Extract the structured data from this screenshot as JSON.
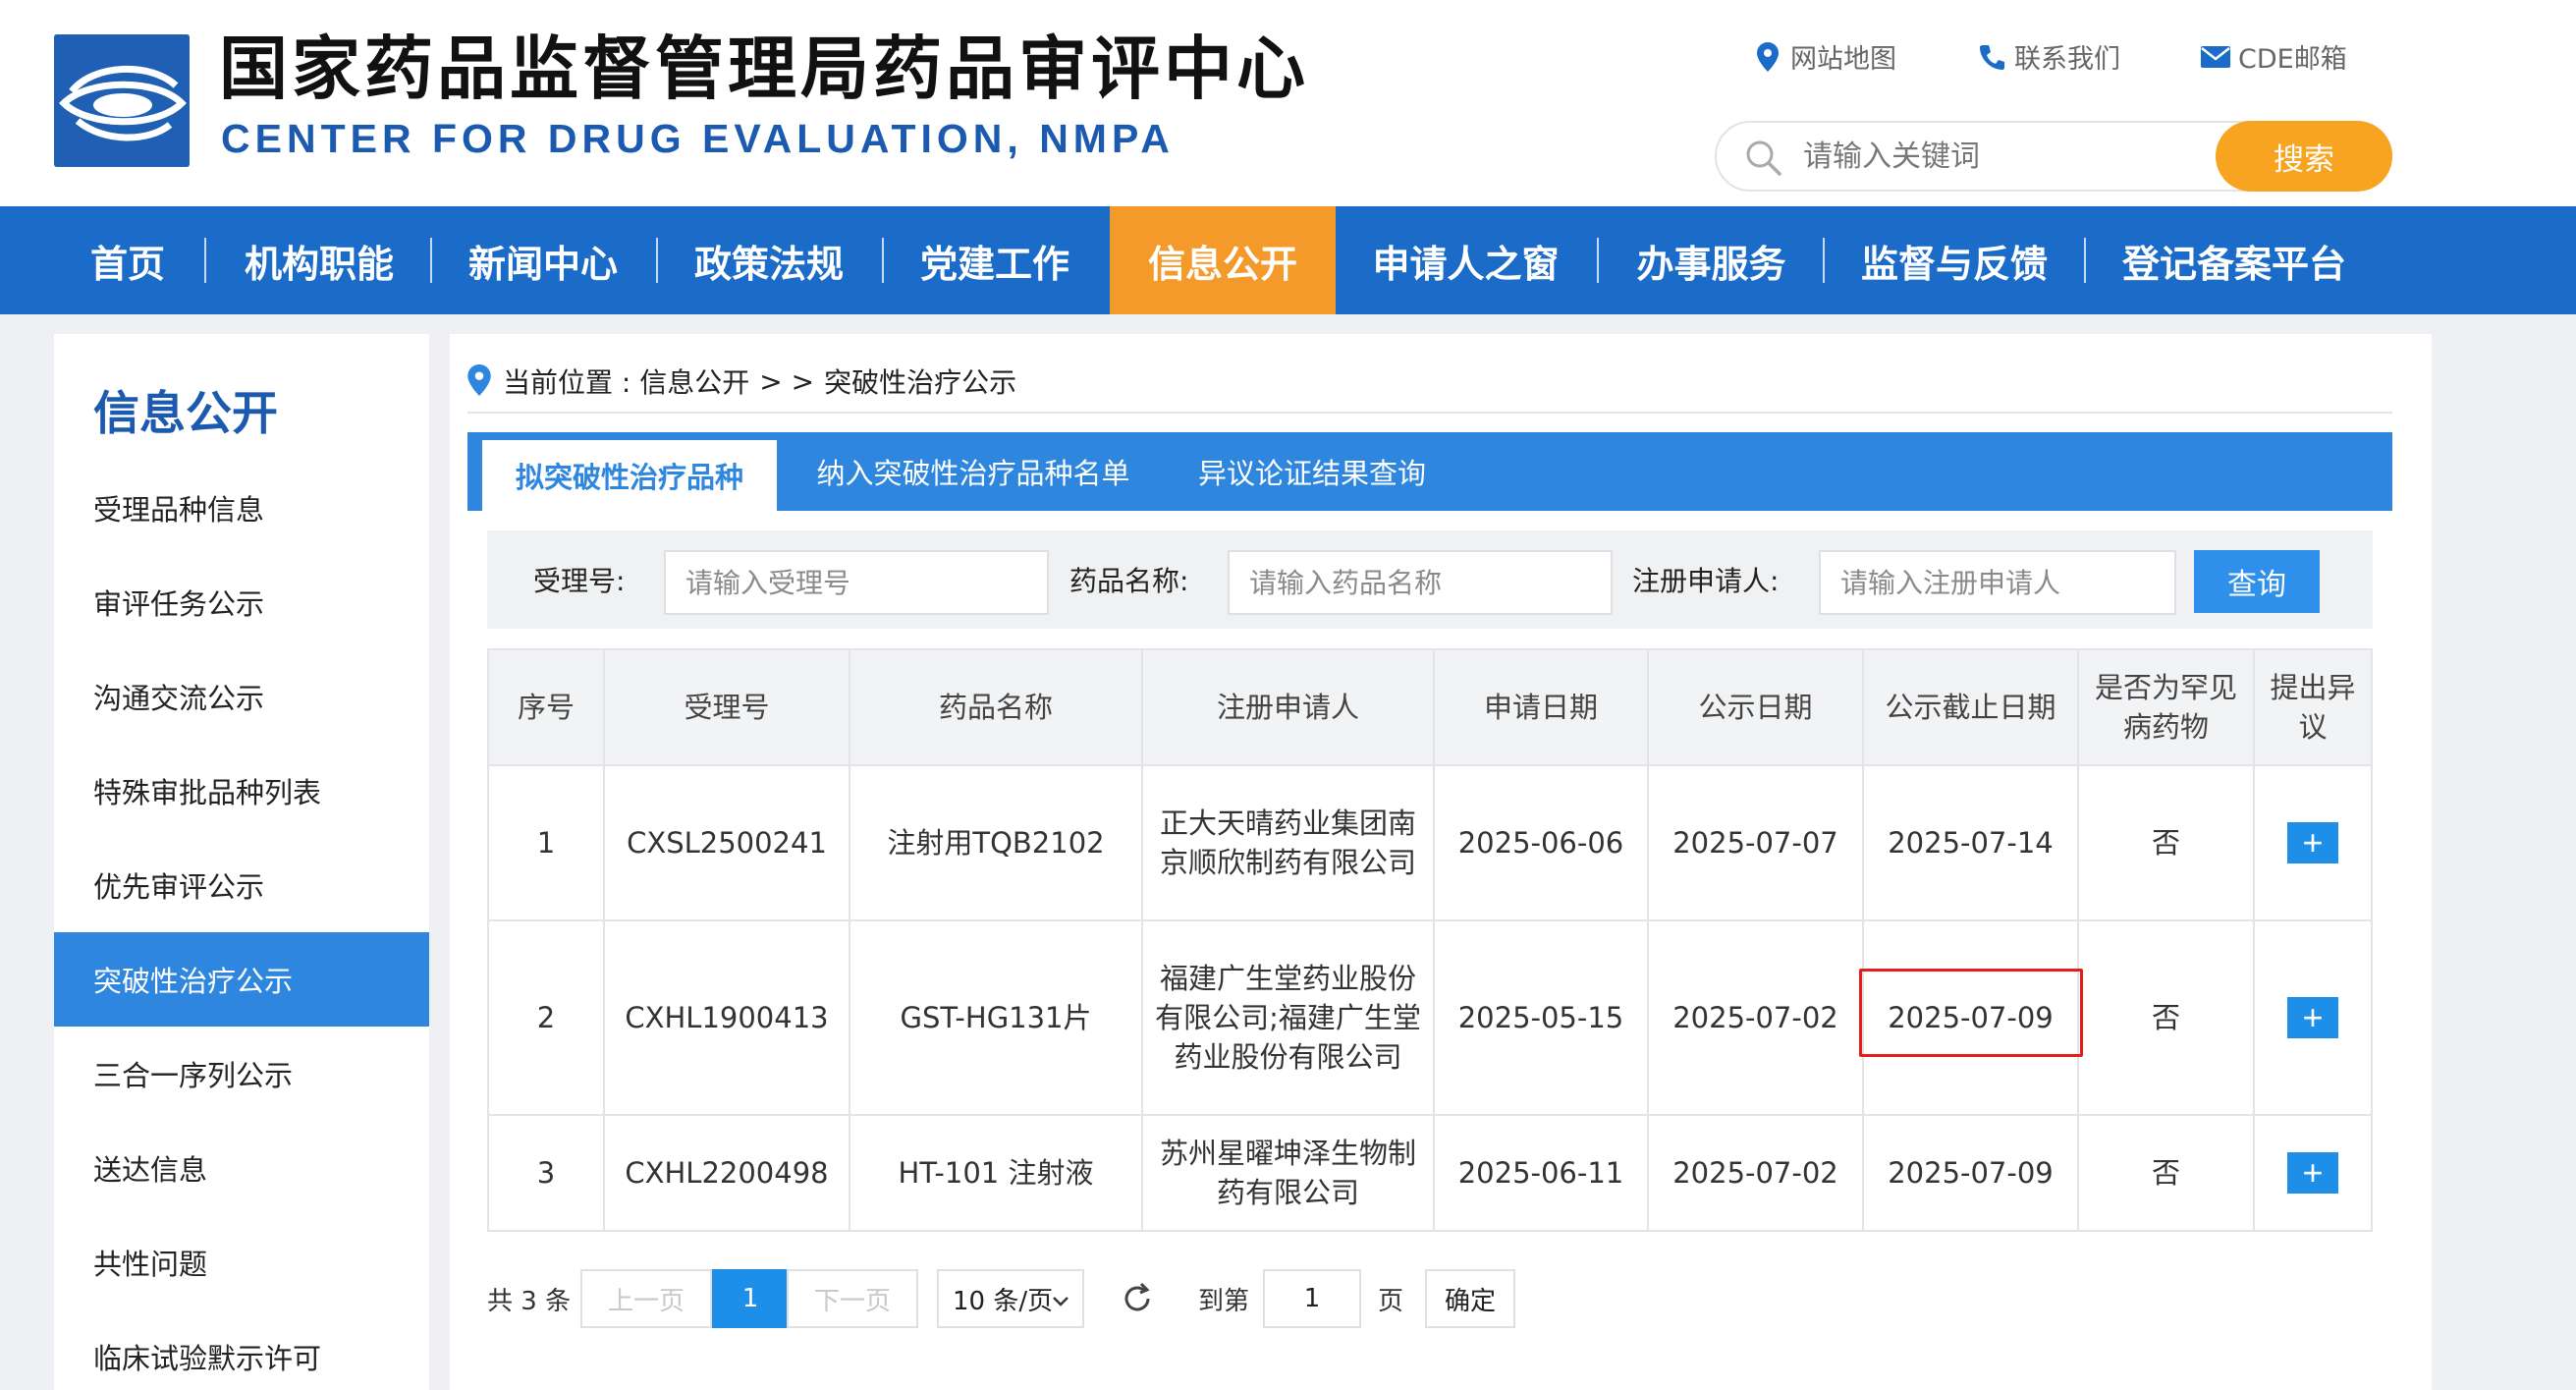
{
  "header": {
    "title_cn": "国家药品监督管理局药品审评中心",
    "title_en": "CENTER FOR DRUG EVALUATION, NMPA",
    "links": [
      {
        "label": "网站地图",
        "icon": "location-pin-icon"
      },
      {
        "label": "联系我们",
        "icon": "phone-icon"
      },
      {
        "label": "CDE邮箱",
        "icon": "mail-icon"
      }
    ],
    "search_placeholder": "请输入关键词",
    "search_button": "搜索"
  },
  "nav": {
    "items": [
      "首页",
      "机构职能",
      "新闻中心",
      "政策法规",
      "党建工作",
      "信息公开",
      "申请人之窗",
      "办事服务",
      "监督与反馈",
      "登记备案平台"
    ],
    "active": "信息公开"
  },
  "sidebar": {
    "title": "信息公开",
    "items": [
      "受理品种信息",
      "审评任务公示",
      "沟通交流公示",
      "特殊审批品种列表",
      "优先审评公示",
      "突破性治疗公示",
      "三合一序列公示",
      "送达信息",
      "共性问题",
      "临床试验默示许可"
    ],
    "active": "突破性治疗公示"
  },
  "breadcrumb": {
    "prefix": "当前位置 : 信息公开",
    "separator": "> >",
    "current": "突破性治疗公示"
  },
  "tabs": [
    "拟突破性治疗品种",
    "纳入突破性治疗品种名单",
    "异议论证结果查询"
  ],
  "filter": {
    "fields": [
      {
        "label": "受理号:",
        "placeholder": "请输入受理号"
      },
      {
        "label": "药品名称:",
        "placeholder": "请输入药品名称"
      },
      {
        "label": "注册申请人:",
        "placeholder": "请输入注册申请人"
      }
    ],
    "query_button": "查询"
  },
  "table": {
    "headers": [
      "序号",
      "受理号",
      "药品名称",
      "注册申请人",
      "申请日期",
      "公示日期",
      "公示截止日期",
      "是否为罕见病药物",
      "提出异议"
    ],
    "rows": [
      {
        "no": "1",
        "accept_no": "CXSL2500241",
        "drug": "注射用TQB2102",
        "applicant": "正大天晴药业集团南京顺欣制药有限公司",
        "apply_date": "2025-06-06",
        "publish_date": "2025-07-07",
        "deadline": "2025-07-14",
        "rare": "否",
        "action": "+"
      },
      {
        "no": "2",
        "accept_no": "CXHL1900413",
        "drug": "GST-HG131片",
        "applicant": "福建广生堂药业股份有限公司;福建广生堂药业股份有限公司",
        "apply_date": "2025-05-15",
        "publish_date": "2025-07-02",
        "deadline": "2025-07-09",
        "rare": "否",
        "action": "+"
      },
      {
        "no": "3",
        "accept_no": "CXHL2200498",
        "drug": "HT-101 注射液",
        "applicant": "苏州星曜坤泽生物制药有限公司",
        "apply_date": "2025-06-11",
        "publish_date": "2025-07-02",
        "deadline": "2025-07-09",
        "rare": "否",
        "action": "+"
      }
    ]
  },
  "pagination": {
    "total": "共 3 条",
    "prev": "上一页",
    "current_page": "1",
    "next": "下一页",
    "page_size": "10 条/页",
    "goto_label": "到第",
    "goto_value": "1",
    "page_unit": "页",
    "confirm": "确定"
  },
  "colors": {
    "nav_bg": "#1b6bc9",
    "nav_active": "#f39a2b",
    "tab_bg": "#2e86de",
    "search_btn": "#f8a421",
    "highlight": "#e51c1c"
  }
}
